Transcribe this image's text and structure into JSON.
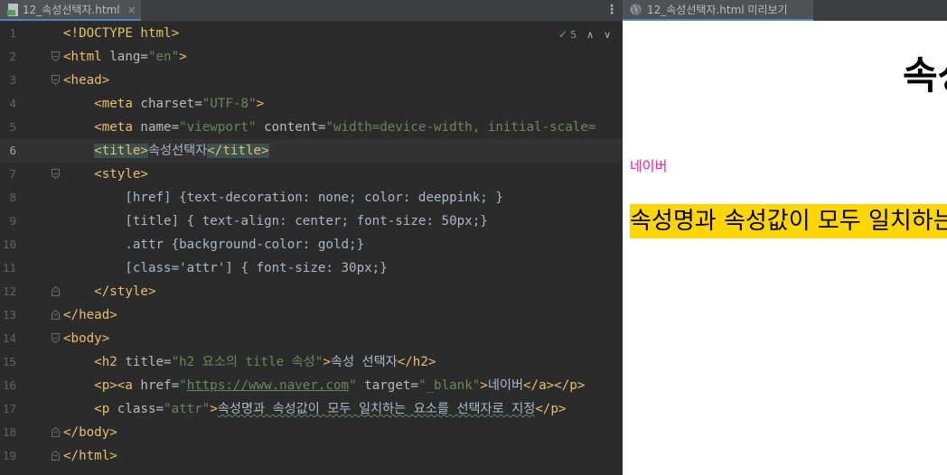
{
  "editor": {
    "tab": {
      "label": "12_속성선택자.html",
      "close": "×"
    },
    "inspection": {
      "count": "5"
    },
    "lines": [
      {
        "n": "1",
        "parts": [
          [
            "t",
            "<!DOCTYPE html>"
          ]
        ]
      },
      {
        "n": "2",
        "parts": [
          [
            "t",
            "<html "
          ],
          [
            "a",
            "lang="
          ],
          [
            "s",
            "\"en\""
          ],
          [
            "t",
            ">"
          ]
        ]
      },
      {
        "n": "3",
        "parts": [
          [
            "t",
            "<head>"
          ]
        ]
      },
      {
        "n": "4",
        "parts": [
          [
            "txt",
            "    "
          ],
          [
            "t",
            "<meta "
          ],
          [
            "a",
            "charset="
          ],
          [
            "s",
            "\"UTF-8\""
          ],
          [
            "t",
            ">"
          ]
        ]
      },
      {
        "n": "5",
        "parts": [
          [
            "txt",
            "    "
          ],
          [
            "t",
            "<meta "
          ],
          [
            "a",
            "name="
          ],
          [
            "s",
            "\"viewport\""
          ],
          [
            "a",
            " content="
          ],
          [
            "s",
            "\"width=device-width, initial-scale="
          ]
        ]
      },
      {
        "n": "6",
        "parts": [
          [
            "txt",
            "    "
          ],
          [
            "tsel",
            "<title>"
          ],
          [
            "txt",
            "속성선택자"
          ],
          [
            "tsel",
            "</title>"
          ]
        ]
      },
      {
        "n": "7",
        "parts": [
          [
            "txt",
            "    "
          ],
          [
            "t",
            "<style>"
          ]
        ]
      },
      {
        "n": "8",
        "parts": [
          [
            "txt",
            "        [href] {text-decoration: none; color: deeppink; }"
          ]
        ]
      },
      {
        "n": "9",
        "parts": [
          [
            "txt",
            "        [title] { text-align: center; font-size: 50px;}"
          ]
        ]
      },
      {
        "n": "10",
        "parts": [
          [
            "txt",
            "        .attr {background-color: gold;}"
          ]
        ]
      },
      {
        "n": "11",
        "parts": [
          [
            "txt",
            "        [class='attr'] { font-size: 30px;}"
          ]
        ]
      },
      {
        "n": "12",
        "parts": [
          [
            "txt",
            "    "
          ],
          [
            "t",
            "</style>"
          ]
        ]
      },
      {
        "n": "13",
        "parts": [
          [
            "t",
            "</head>"
          ]
        ]
      },
      {
        "n": "14",
        "parts": [
          [
            "t",
            "<body>"
          ]
        ]
      },
      {
        "n": "15",
        "parts": [
          [
            "txt",
            "    "
          ],
          [
            "t",
            "<h2 "
          ],
          [
            "a",
            "title="
          ],
          [
            "s",
            "\"h2 요소의 title 속성\""
          ],
          [
            "t",
            ">"
          ],
          [
            "txt",
            "속성 선택자"
          ],
          [
            "t",
            "</h2>"
          ]
        ]
      },
      {
        "n": "16",
        "parts": [
          [
            "txt",
            "    "
          ],
          [
            "t",
            "<p><a "
          ],
          [
            "a",
            "href="
          ],
          [
            "s",
            "\""
          ],
          [
            "su",
            "https://www.naver.com"
          ],
          [
            "s",
            "\""
          ],
          [
            "a",
            " target="
          ],
          [
            "s",
            "\"_blank\""
          ],
          [
            "t",
            ">"
          ],
          [
            "txt",
            "네이버"
          ],
          [
            "t",
            "</a></p>"
          ]
        ]
      },
      {
        "n": "17",
        "parts": [
          [
            "txt",
            "    "
          ],
          [
            "t",
            "<p "
          ],
          [
            "a",
            "class="
          ],
          [
            "s",
            "\"attr\""
          ],
          [
            "t",
            ">"
          ],
          [
            "sq",
            "속성명과 속성값이 모두 일치하는 요소를 선택자로 지정"
          ],
          [
            "t",
            "</p>"
          ]
        ]
      },
      {
        "n": "18",
        "parts": [
          [
            "t",
            "</body>"
          ]
        ]
      },
      {
        "n": "19",
        "parts": [
          [
            "t",
            "</html>"
          ]
        ]
      }
    ]
  },
  "preview": {
    "tab": {
      "label": "12_속성선택자.html 미리보기"
    },
    "h2": "속성 선택자",
    "link": "네이버",
    "attr_paragraph": "속성명과 속성값이 모두 일치하는 요소를 선택자로 지정",
    "colors": {
      "link": "#ff1493",
      "attr_bg": "#ffd700"
    }
  }
}
